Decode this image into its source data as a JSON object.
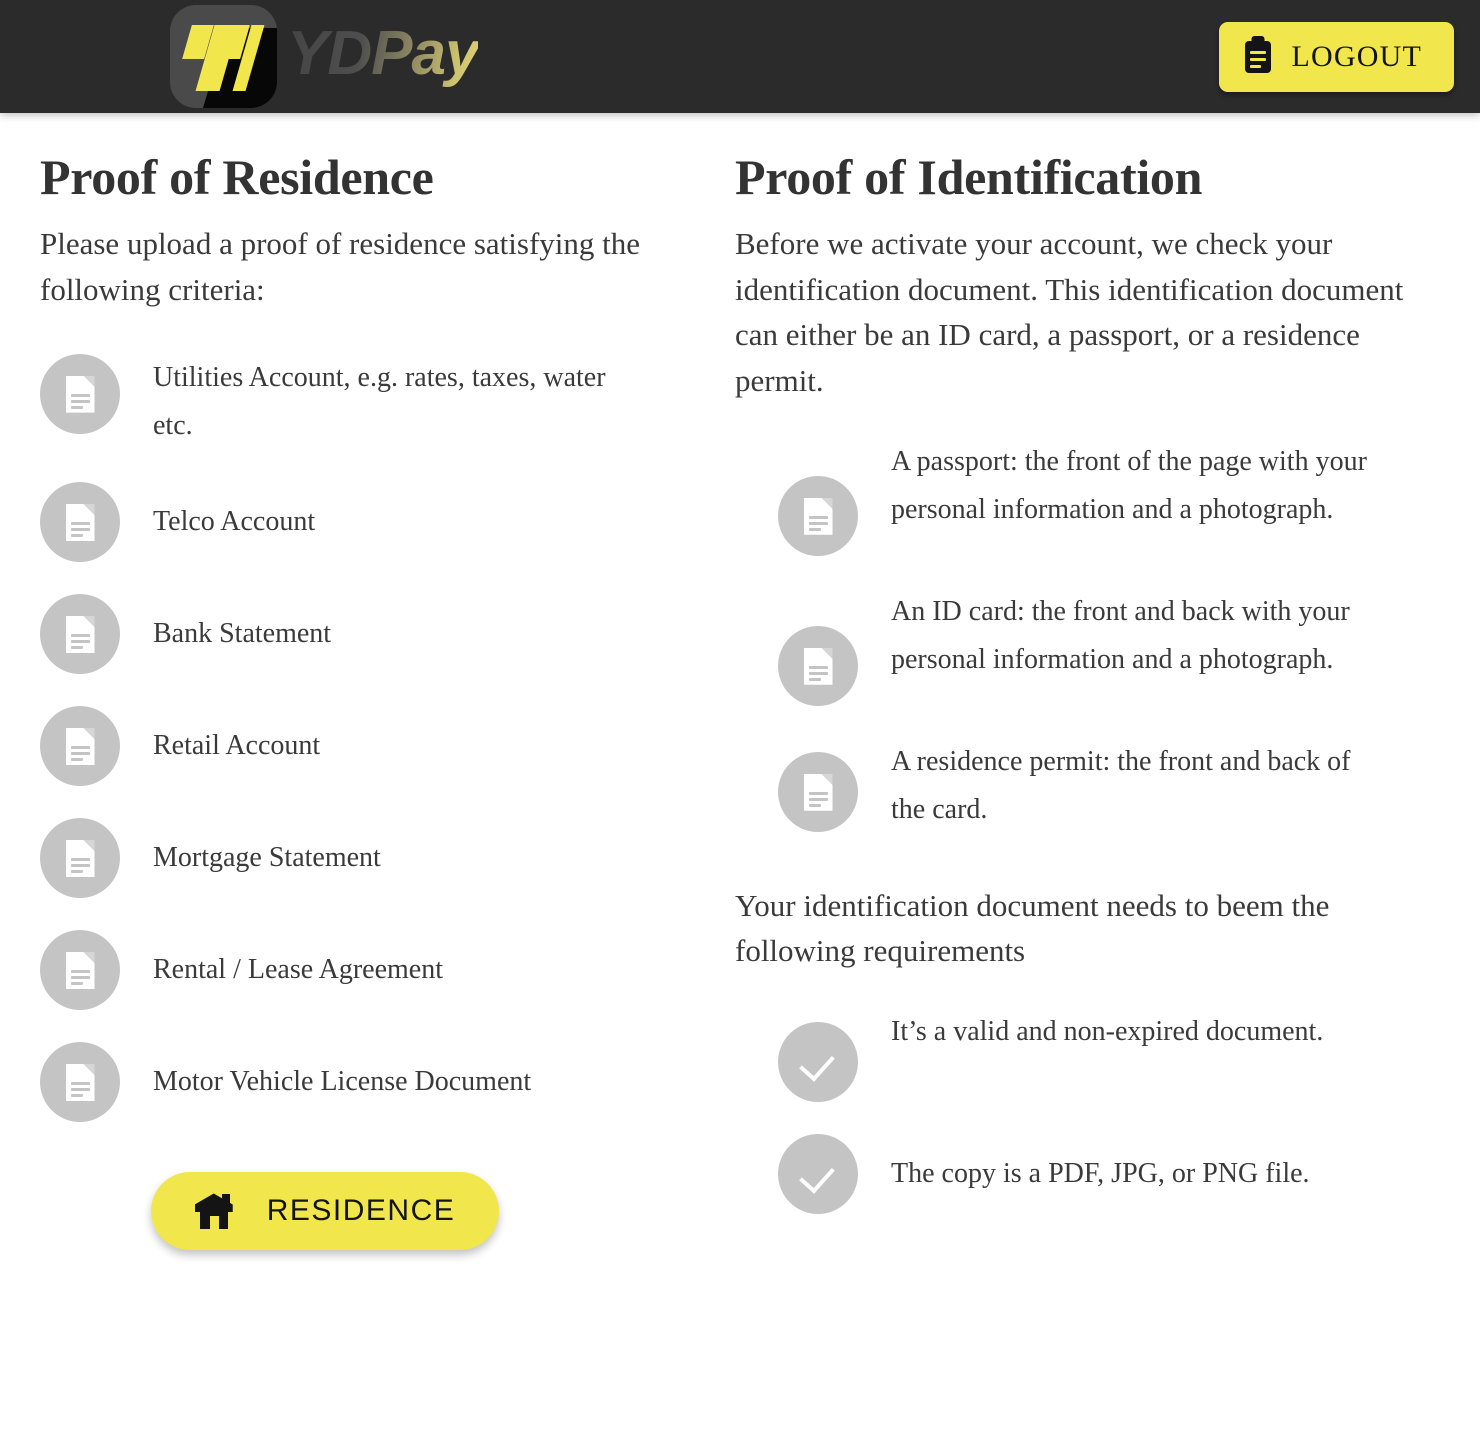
{
  "header": {
    "logo_icon": "ydpay-logo-mark",
    "brand_name": "YDPay",
    "logout": {
      "label": "LOGOUT",
      "icon": "clipboard-icon"
    },
    "background_color": "#2b2b2b",
    "accent_color": "#f2e64d"
  },
  "residence": {
    "title": "Proof of Residence",
    "intro": "Please upload a proof of residence satisfying the following criteria:",
    "items": [
      {
        "icon": "document-icon",
        "text": "Utilities Account, e.g. rates, taxes, water etc."
      },
      {
        "icon": "document-icon",
        "text": "Telco Account"
      },
      {
        "icon": "document-icon",
        "text": "Bank Statement"
      },
      {
        "icon": "document-icon",
        "text": "Retail Account"
      },
      {
        "icon": "document-icon",
        "text": "Mortgage Statement"
      },
      {
        "icon": "document-icon",
        "text": "Rental / Lease Agreement"
      },
      {
        "icon": "document-icon",
        "text": "Motor Vehicle License Document"
      }
    ],
    "button": {
      "label": "RESIDENCE",
      "icon": "home-icon"
    }
  },
  "identification": {
    "title": "Proof of Identification",
    "intro": "Before we activate your account, we check your identification document. This identification document can either be an ID card, a passport, or a residence permit.",
    "items": [
      {
        "icon": "document-icon",
        "text": "A passport: the front of the page with your personal information and a photograph."
      },
      {
        "icon": "document-icon",
        "text": "An ID card: the front and back with your personal information and a photograph."
      },
      {
        "icon": "document-icon",
        "text": "A residence permit: the front and back of the card."
      }
    ],
    "requirements_heading": "Your identification document needs to beem the following requirements",
    "requirements": [
      {
        "icon": "check-icon",
        "text": "It’s a valid and non-expired document."
      },
      {
        "icon": "check-icon",
        "text": "The copy is a PDF, JPG, or PNG file."
      }
    ]
  },
  "colors": {
    "accent_yellow": "#f2e64d",
    "header_dark": "#2b2b2b",
    "icon_circle_gray": "#c4c4c4",
    "body_text": "#3a3a3a"
  }
}
